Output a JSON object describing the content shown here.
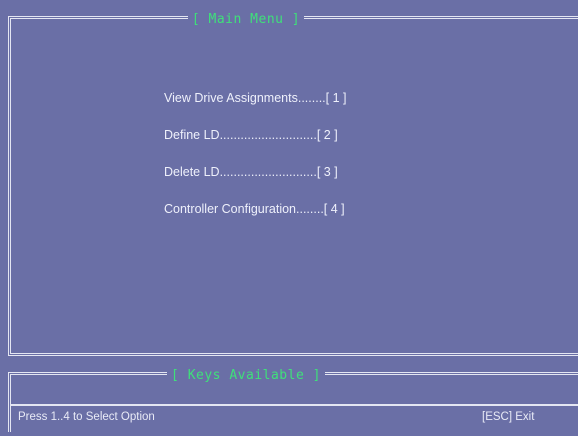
{
  "main_window": {
    "title": "[ Main Menu ]",
    "menu_items": [
      {
        "label": "View Drive Assignments........[ 1 ]"
      },
      {
        "label": "Define LD............................[ 2 ]"
      },
      {
        "label": "Delete LD............................[ 3 ]"
      },
      {
        "label": "Controller Configuration........[ 4 ]"
      }
    ]
  },
  "keys_window": {
    "title": "[ Keys Available ]",
    "hint_left": "Press 1..4 to Select Option",
    "hint_right": "[ESC] Exit"
  },
  "colors": {
    "background": "#6a6fa6",
    "title_text": "#3fe07a",
    "text": "#eef0fb",
    "frame": "#e4e6f2"
  }
}
